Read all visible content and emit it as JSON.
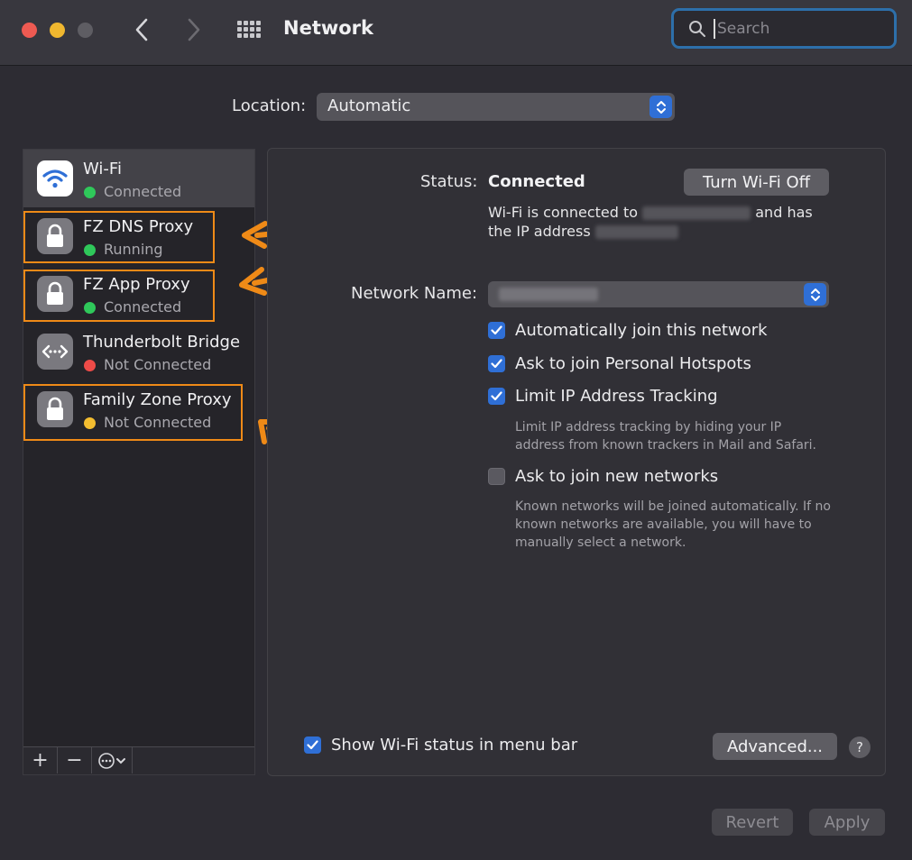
{
  "window": {
    "title": "Network"
  },
  "search": {
    "placeholder": "Search"
  },
  "location": {
    "label": "Location:",
    "value": "Automatic"
  },
  "services": [
    {
      "name": "Wi-Fi",
      "status": "Connected",
      "status_color": "#2fc85a",
      "icon": "wifi-icon"
    },
    {
      "name": "FZ DNS Proxy",
      "status": "Running",
      "status_color": "#2fc85a",
      "icon": "lock-icon"
    },
    {
      "name": "FZ App Proxy",
      "status": "Connected",
      "status_color": "#2fc85a",
      "icon": "lock-icon"
    },
    {
      "name": "Thunderbolt Bridge",
      "status": "Not Connected",
      "status_color": "#ee4b48",
      "icon": "bridge-icon"
    },
    {
      "name": "Family Zone Proxy",
      "status": "Not Connected",
      "status_color": "#f3bd30",
      "icon": "lock-icon"
    }
  ],
  "sidebar_toolbar": {
    "add": "+",
    "remove": "−"
  },
  "detail": {
    "status_label": "Status:",
    "status_value": "Connected",
    "turn_off_button": "Turn Wi-Fi Off",
    "desc_line1_a": "Wi-Fi is connected to",
    "desc_line1_b": "and has",
    "desc_line2": "the IP address",
    "network_name_label": "Network Name:",
    "options": [
      {
        "label": "Automatically join this network",
        "checked": true
      },
      {
        "label": "Ask to join Personal Hotspots",
        "checked": true
      },
      {
        "label": "Limit IP Address Tracking",
        "checked": true
      },
      {
        "label": "Ask to join new networks",
        "checked": false
      }
    ],
    "limit_hint": [
      "Limit IP address tracking by hiding your IP",
      "address from known trackers in Mail and Safari."
    ],
    "new_networks_hint": [
      "Known networks will be joined automatically. If no",
      "known networks are available, you will have to",
      "manually select a network."
    ],
    "show_status_label": "Show Wi-Fi status in menu bar",
    "advanced_button": "Advanced...",
    "help_button": "?"
  },
  "footer": {
    "revert_button": "Revert",
    "apply_button": "Apply"
  },
  "colors": {
    "accent": "#2f6fd6",
    "highlight": "#ef8a17"
  }
}
